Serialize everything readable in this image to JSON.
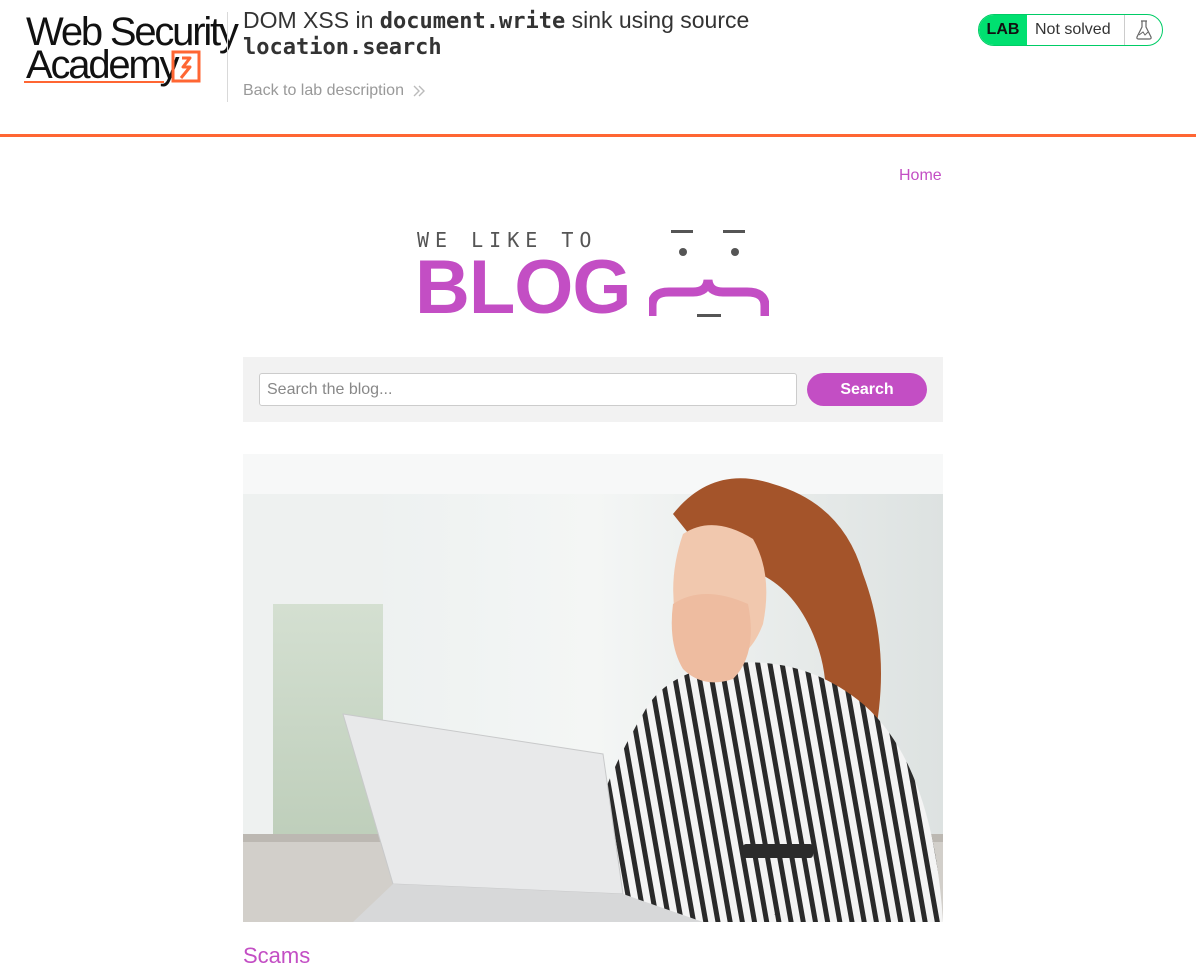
{
  "academy": {
    "logo_line1": "Web Security",
    "logo_line2": "Academy",
    "title_prefix": "DOM XSS in ",
    "title_code1": "document.write",
    "title_mid": " sink using source",
    "title_code2": "location.search",
    "back_link": "Back to lab description",
    "status": {
      "badge": "LAB",
      "text": "Not solved",
      "icon": "flask-icon",
      "accent": "#00e070"
    }
  },
  "nav": {
    "home": "Home"
  },
  "banner": {
    "tagline": "WE LIKE TO",
    "word": "BLOG"
  },
  "search": {
    "placeholder": "Search the blog...",
    "value": "",
    "button": "Search"
  },
  "post": {
    "title": "Scams",
    "image": "woman-covering-mouth-at-laptop"
  },
  "colors": {
    "brand": "#c34ec4",
    "header_rule": "#ff6633",
    "panel": "#f2f2f2"
  }
}
